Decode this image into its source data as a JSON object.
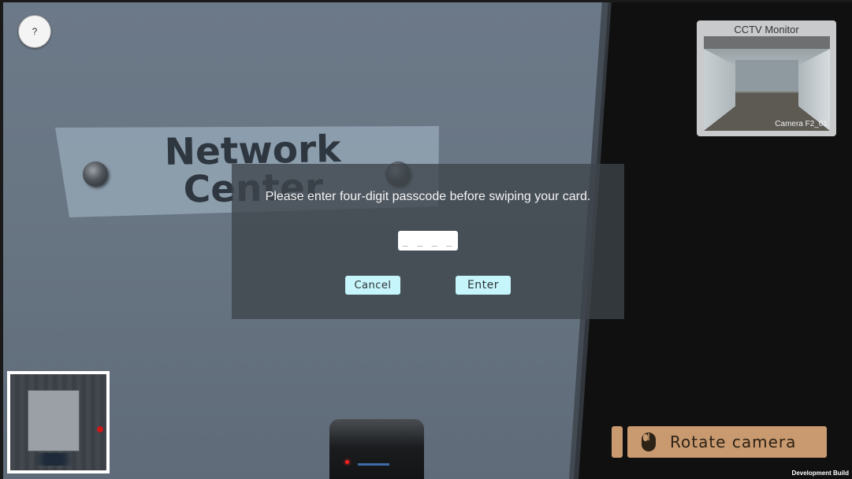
{
  "help": {
    "label": "?"
  },
  "sign": {
    "line1": "Network",
    "line2": "Center"
  },
  "dialog": {
    "message": "Please enter four-digit passcode before swiping your card.",
    "passcode": {
      "value": "",
      "placeholder": "_ _ _ _"
    },
    "cancel_label": "Cancel",
    "enter_label": "Enter"
  },
  "cctv": {
    "title": "CCTV Monitor",
    "camera": "Camera F2_01"
  },
  "hint": {
    "label": "Rotate camera",
    "icon": "mouse-icon"
  },
  "footer": {
    "build": "Development Build"
  },
  "colors": {
    "button_bg": "#c6f6fb",
    "hint_bg": "#c99a6f",
    "dialog_bg": "#3e444a"
  }
}
